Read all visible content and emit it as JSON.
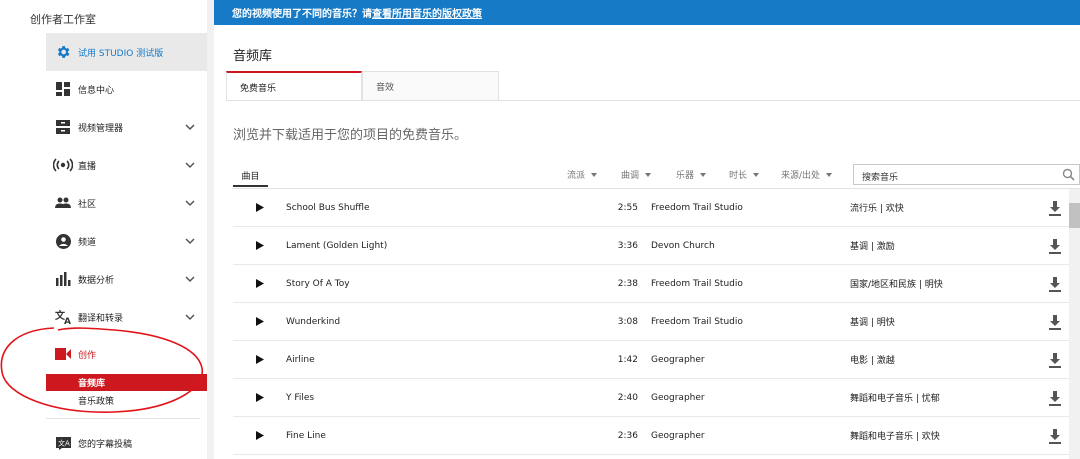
{
  "sidebar": {
    "title": "创作者工作室",
    "trial_label": "试用 STUDIO 测试版",
    "items": [
      {
        "label": "信息中心",
        "icon": "dashboard-icon",
        "chevron": false
      },
      {
        "label": "视频管理器",
        "icon": "video-manager-icon",
        "chevron": true
      },
      {
        "label": "直播",
        "icon": "live-icon",
        "chevron": true
      },
      {
        "label": "社区",
        "icon": "community-icon",
        "chevron": true
      },
      {
        "label": "频道",
        "icon": "channel-icon",
        "chevron": true
      },
      {
        "label": "数据分析",
        "icon": "analytics-icon",
        "chevron": true
      },
      {
        "label": "翻译和转录",
        "icon": "translate-icon",
        "chevron": true
      },
      {
        "label": "创作",
        "icon": "create-icon",
        "chevron": false
      }
    ],
    "sub_items": [
      {
        "label": "音频库",
        "active": true
      },
      {
        "label": "音乐政策",
        "active": false
      }
    ],
    "bottom_item": {
      "label": "您的字幕投稿",
      "icon": "subtitles-icon"
    }
  },
  "banner": {
    "text": "您的视频使用了不同的音乐？请",
    "link": "查看所用音乐的版权政策"
  },
  "page": {
    "title": "音频库",
    "tabs": [
      {
        "label": "免费音乐",
        "active": true
      },
      {
        "label": "音效",
        "active": false
      }
    ],
    "subtitle": "浏览并下载适用于您的项目的免费音乐。"
  },
  "filters": {
    "track_col": "曲目",
    "genre": "流派",
    "mood": "曲调",
    "instrument": "乐器",
    "duration": "时长",
    "source": "来源/出处",
    "search_placeholder": "搜索音乐"
  },
  "tracks": [
    {
      "title": "School Bus Shuffle",
      "duration": "2:55",
      "artist": "Freedom Trail Studio",
      "genre": "流行乐 | 欢快"
    },
    {
      "title": "Lament (Golden Light)",
      "duration": "3:36",
      "artist": "Devon Church",
      "genre": "基调 | 激励"
    },
    {
      "title": "Story Of A Toy",
      "duration": "2:38",
      "artist": "Freedom Trail Studio",
      "genre": "国家/地区和民族 | 明快"
    },
    {
      "title": "Wunderkind",
      "duration": "3:08",
      "artist": "Freedom Trail Studio",
      "genre": "基调 | 明快"
    },
    {
      "title": "Airline",
      "duration": "1:42",
      "artist": "Geographer",
      "genre": "电影 | 激越"
    },
    {
      "title": "Y Files",
      "duration": "2:40",
      "artist": "Geographer",
      "genre": "舞蹈和电子音乐 | 忧郁"
    },
    {
      "title": "Fine Line",
      "duration": "2:36",
      "artist": "Geographer",
      "genre": "舞蹈和电子音乐 | 欢快"
    }
  ],
  "colors": {
    "brand_blue": "#167ac6",
    "accent_red": "#cc181e",
    "annotation_red": "#e2141b"
  }
}
